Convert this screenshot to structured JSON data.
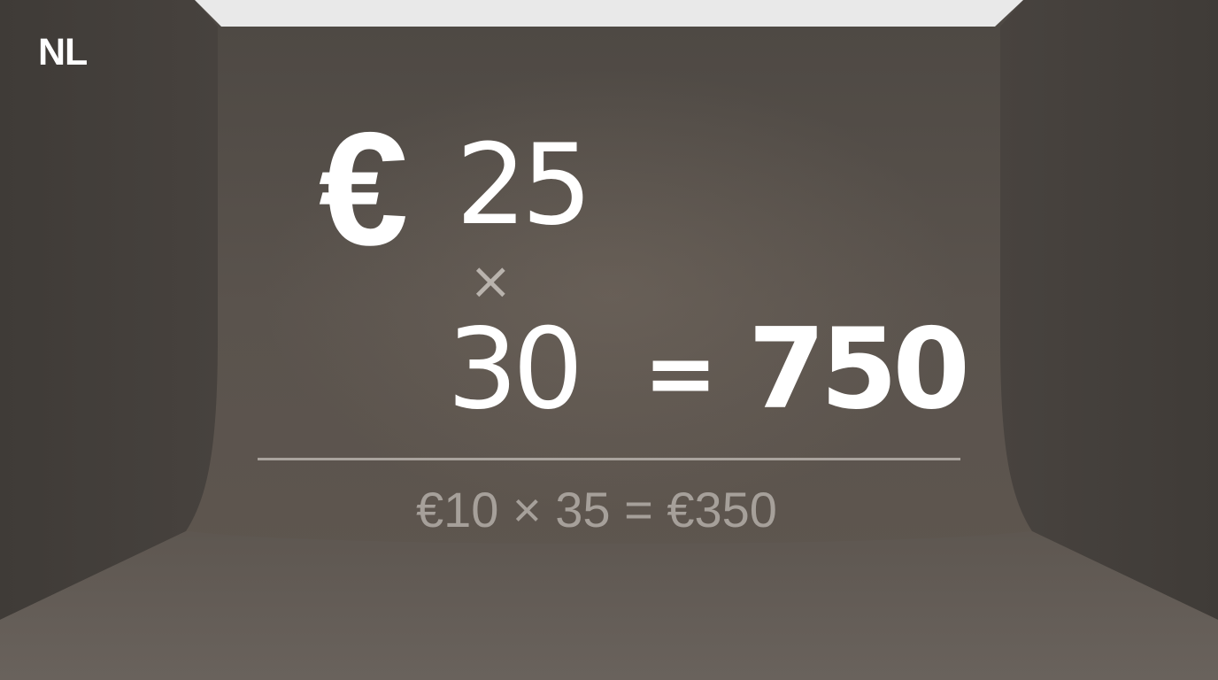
{
  "corner_label": "NL",
  "calculation": {
    "currency_symbol": "€",
    "price": "25",
    "times_symbol": "×",
    "quantity": "30",
    "equals_symbol": "=",
    "total": "750"
  },
  "example": "€10 × 35 = €350",
  "colors": {
    "background": "#4f4a45",
    "ceiling_light": "#e9e9e9",
    "primary_text": "#ffffff",
    "muted_text": "#a6a09a",
    "divider": "#a9a39d"
  }
}
